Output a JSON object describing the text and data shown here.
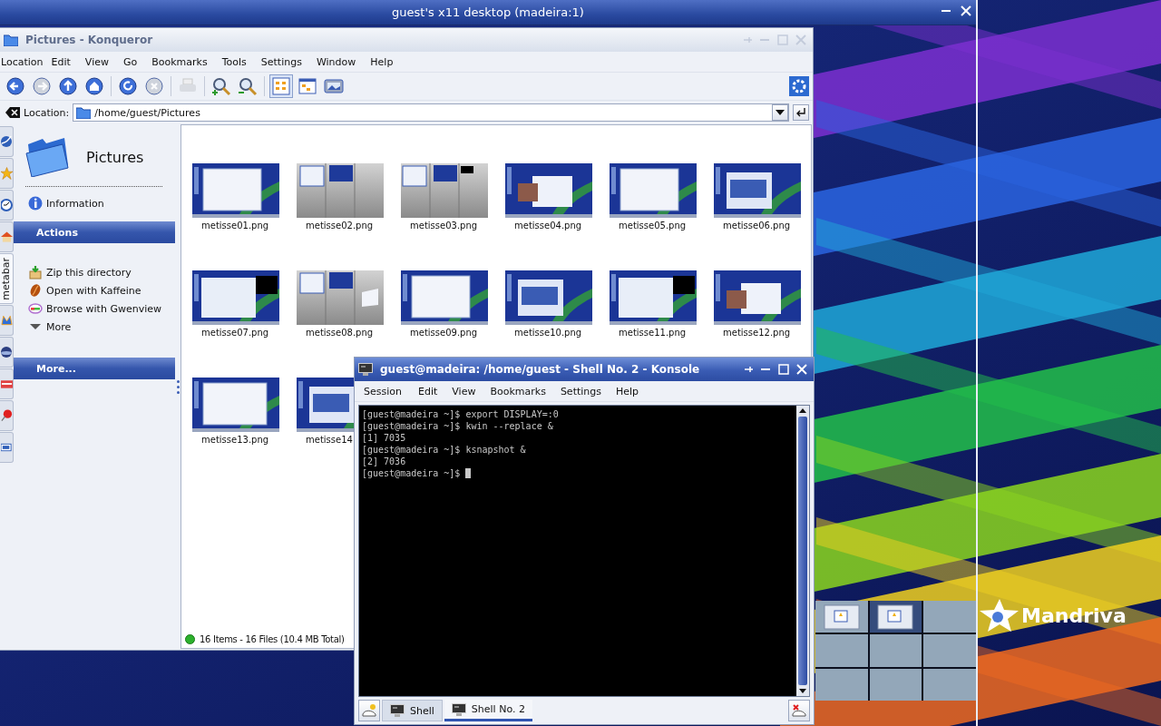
{
  "vnc_window": {
    "title": "guest's x11 desktop (madeira:1)"
  },
  "konqueror": {
    "title": "Pictures - Konqueror",
    "menu": [
      "Location",
      "Edit",
      "View",
      "Go",
      "Bookmarks",
      "Tools",
      "Settings",
      "Window",
      "Help"
    ],
    "toolbar": [
      {
        "kind": "back",
        "disabled": false
      },
      {
        "kind": "forward",
        "disabled": true
      },
      {
        "kind": "up",
        "disabled": false
      },
      {
        "kind": "home",
        "disabled": false
      },
      {
        "kind": "reload",
        "disabled": false
      },
      {
        "kind": "stop",
        "disabled": true
      },
      {
        "kind": "print",
        "disabled": true
      },
      {
        "kind": "zoomin",
        "disabled": false
      },
      {
        "kind": "zoomout",
        "disabled": false
      },
      {
        "kind": "iconview",
        "disabled": false
      },
      {
        "kind": "treeview",
        "disabled": false
      },
      {
        "kind": "imageview",
        "disabled": false
      }
    ],
    "location": {
      "label": "Location:",
      "value": "/home/guest/Pictures"
    },
    "sidebar_tabs": [
      {
        "kind": "web",
        "selected": false
      },
      {
        "kind": "star",
        "selected": false
      },
      {
        "kind": "clock",
        "selected": false
      },
      {
        "kind": "home",
        "selected": false
      },
      {
        "kind": "text",
        "label": "metabar",
        "selected": true
      },
      {
        "kind": "media",
        "selected": false
      },
      {
        "kind": "globe",
        "selected": false
      },
      {
        "kind": "folder",
        "selected": false
      },
      {
        "kind": "pin",
        "selected": false
      },
      {
        "kind": "screen",
        "selected": false
      }
    ],
    "metabar": {
      "title": "Pictures",
      "info": "Information",
      "sections": [
        {
          "title": "Actions",
          "items": [
            {
              "kind": "zip",
              "label": "Zip this directory"
            },
            {
              "kind": "kaffeine",
              "label": "Open with Kaffeine"
            },
            {
              "kind": "gwenview",
              "label": "Browse with Gwenview"
            },
            {
              "kind": "more",
              "label": "More"
            }
          ]
        },
        {
          "title": "More..."
        }
      ]
    },
    "files": [
      {
        "name": "metisse01.png"
      },
      {
        "name": "metisse02.png"
      },
      {
        "name": "metisse03.png"
      },
      {
        "name": "metisse04.png"
      },
      {
        "name": "metisse05.png"
      },
      {
        "name": "metisse06.png"
      },
      {
        "name": "metisse07.png"
      },
      {
        "name": "metisse08.png"
      },
      {
        "name": "metisse09.png"
      },
      {
        "name": "metisse10.png"
      },
      {
        "name": "metisse11.png"
      },
      {
        "name": "metisse12.png"
      },
      {
        "name": "metisse13.png"
      },
      {
        "name": "metisse14"
      }
    ],
    "status": "16 Items - 16 Files (10.4 MB Total)"
  },
  "konsole": {
    "title": "guest@madeira: /home/guest - Shell No. 2 - Konsole",
    "menu": [
      "Session",
      "Edit",
      "View",
      "Bookmarks",
      "Settings",
      "Help"
    ],
    "lines": [
      "[guest@madeira ~]$ export DISPLAY=:0",
      "[guest@madeira ~]$ kwin --replace &",
      "[1] 7035",
      "[guest@madeira ~]$ ksnapshot &",
      "[2] 7036",
      "[guest@madeira ~]$"
    ],
    "tabs": [
      {
        "label": "Shell",
        "selected": false
      },
      {
        "label": "Shell No. 2",
        "selected": true
      }
    ]
  },
  "pager": {
    "desktops": [
      {
        "selected": false,
        "occupied": true
      },
      {
        "selected": true,
        "occupied": true
      },
      {
        "selected": false,
        "occupied": false
      },
      {
        "selected": false,
        "occupied": false
      },
      {
        "selected": false,
        "occupied": false
      },
      {
        "selected": false,
        "occupied": false
      },
      {
        "selected": false,
        "occupied": false
      },
      {
        "selected": false,
        "occupied": false
      },
      {
        "selected": false,
        "occupied": false
      }
    ]
  },
  "logo": {
    "text": "Mandriva"
  }
}
